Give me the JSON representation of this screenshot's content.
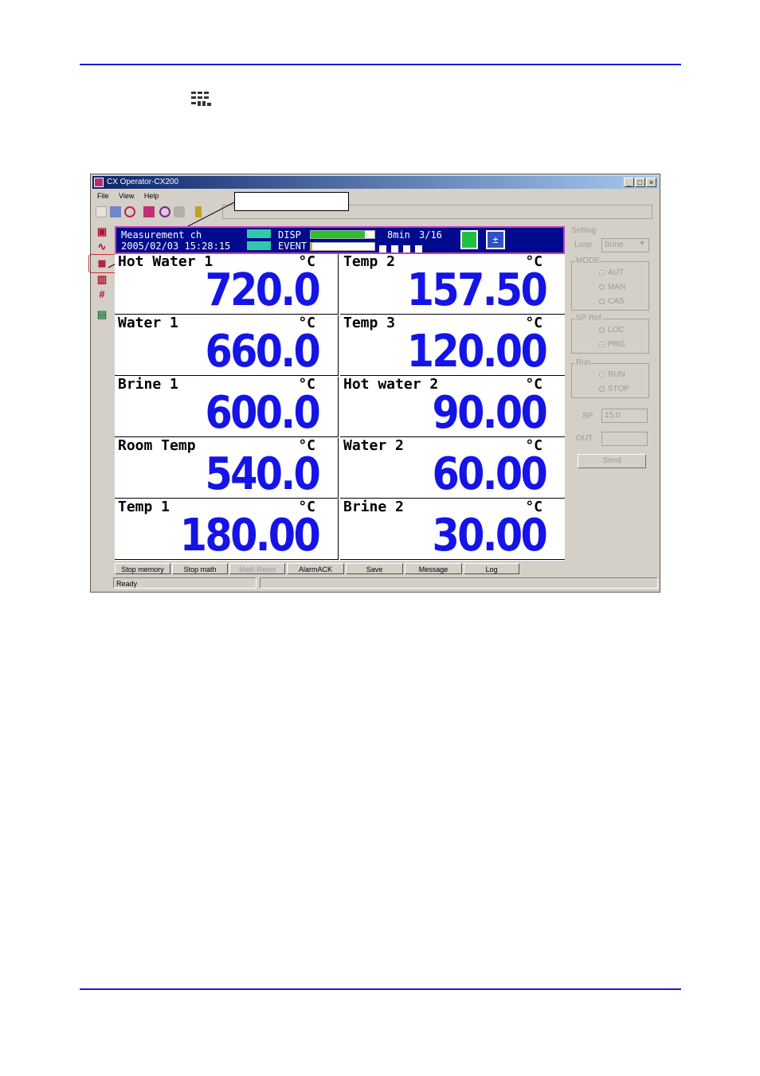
{
  "page": {
    "accent": "#1a1adb"
  },
  "window": {
    "title": "CX Operator-CX200",
    "controls": [
      "_",
      "□",
      "×"
    ],
    "menu": [
      "File",
      "View",
      "Help"
    ]
  },
  "toolbar": {
    "icons": [
      "open-icon",
      "settings-icon",
      "refresh-icon",
      "data-icon",
      "record-icon",
      "forward-icon",
      "help-icon"
    ]
  },
  "sidebar": {
    "icons": [
      "alarm-summary-icon",
      "trend-icon",
      "digital-display-icon",
      "bar-graph-icon",
      "overview-icon",
      "report-icon"
    ]
  },
  "header": {
    "line1": "Measurement ch",
    "line2": "2005/02/03 15:28:15",
    "disp": "DISP",
    "event": "EVENT",
    "interval": "8min",
    "page": "3/16",
    "disp_fill": 0.85,
    "event_fill": 0.03
  },
  "channels": [
    {
      "name": "Hot Water 1",
      "unit": "°C",
      "value": "720.0"
    },
    {
      "name": "Temp 2",
      "unit": "°C",
      "value": "157.50"
    },
    {
      "name": "Water 1",
      "unit": "°C",
      "value": "660.0"
    },
    {
      "name": "Temp 3",
      "unit": "°C",
      "value": "120.00"
    },
    {
      "name": "Brine 1",
      "unit": "°C",
      "value": "600.0"
    },
    {
      "name": "Hot water 2",
      "unit": "°C",
      "value": "90.00"
    },
    {
      "name": "Room Temp",
      "unit": "°C",
      "value": "540.0"
    },
    {
      "name": "Water 2",
      "unit": "°C",
      "value": "60.00"
    },
    {
      "name": "Temp 1",
      "unit": "°C",
      "value": "180.00"
    },
    {
      "name": "Brine 2",
      "unit": "°C",
      "value": "30.00"
    }
  ],
  "panel": {
    "setting": "Setting",
    "loop_label": "Loop",
    "loop_value": "Brine",
    "mode": {
      "title": "MODE",
      "options": [
        "AUT",
        "MAN",
        "CAS"
      ],
      "selected": "AUT"
    },
    "spref": {
      "title": "SP Ref",
      "options": [
        "LOC",
        "PRG"
      ],
      "selected": "PRG"
    },
    "run": {
      "title": "Run",
      "options": [
        "RUN",
        "STOP"
      ],
      "selected": "RUN"
    },
    "sp_label": "SP",
    "sp_value": "15.0",
    "out_label": "OUT",
    "send": "Send"
  },
  "buttons": [
    "Stop memory",
    "Stop math",
    "Math Reset",
    "AlarmACK",
    "Save",
    "Message",
    "Log"
  ],
  "status": {
    "text": "Ready"
  }
}
